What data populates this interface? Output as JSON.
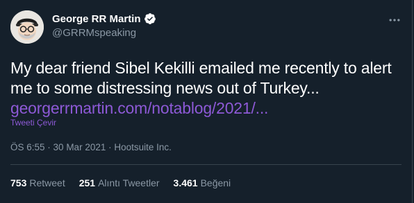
{
  "tweet": {
    "author_name": "George RR Martin",
    "author_handle": "@GRRMspeaking",
    "text_line1": "My dear friend Sibel Kekilli emailed me recently to alert",
    "text_line2": "me to some distressing news out of Turkey...",
    "link_text": "georgerrmartin.com/notablog/2021/...",
    "translate_label": "Tweeti Çevir",
    "time": "ÖS 6:55",
    "date": "30 Mar 2021",
    "source": "Hootsuite Inc.",
    "separator": "·",
    "more_label": "···"
  },
  "stats": {
    "retweets_count": "753",
    "retweets_label": "Retweet",
    "quotes_count": "251",
    "quotes_label": "Alıntı Tweetler",
    "likes_count": "3.461",
    "likes_label": "Beğeni"
  },
  "colors": {
    "background": "#15202b",
    "link": "#8d59d6",
    "secondary_text": "#8b98a5",
    "verified_badge": "#ffffff"
  },
  "icons": {
    "verified": "verified-badge-icon",
    "more": "more-options-icon",
    "avatar": "profile-avatar"
  }
}
